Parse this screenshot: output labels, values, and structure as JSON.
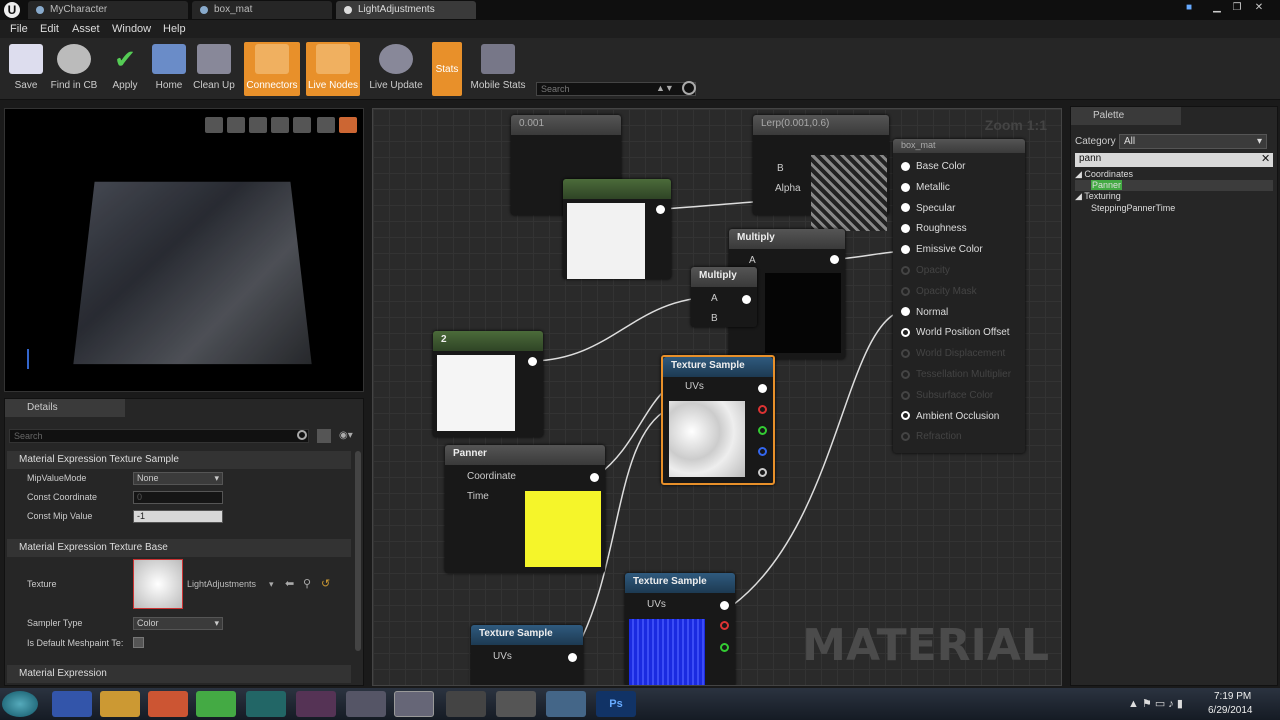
{
  "window": {
    "tabs": [
      "MyCharacter",
      "box_mat",
      "LightAdjustments"
    ],
    "active_tab": 2
  },
  "menu": [
    "File",
    "Edit",
    "Asset",
    "Window",
    "Help"
  ],
  "toolbar": {
    "buttons": [
      {
        "label": "Save",
        "active": false
      },
      {
        "label": "Find in CB",
        "active": false
      },
      {
        "label": "Apply",
        "active": false
      },
      {
        "label": "Home",
        "active": false
      },
      {
        "label": "Clean Up",
        "active": false
      },
      {
        "label": "Connectors",
        "active": true
      },
      {
        "label": "Live Nodes",
        "active": true
      },
      {
        "label": "Live Update",
        "active": false
      },
      {
        "label": "Stats",
        "active": true
      },
      {
        "label": "Mobile Stats",
        "active": false
      }
    ],
    "search_placeholder": "Search"
  },
  "details": {
    "tab": "Details",
    "search_placeholder": "Search",
    "section1": "Material Expression Texture Sample",
    "mip_label": "MipValueMode",
    "mip_value": "None",
    "coord_label": "Const Coordinate",
    "coord_value": "0",
    "constmip_label": "Const Mip Value",
    "constmip_value": "-1",
    "section2": "Material Expression Texture Base",
    "texture_label": "Texture",
    "texture_value": "LightAdjustments",
    "sampler_label": "Sampler Type",
    "sampler_value": "Color",
    "meshpaint_label": "Is Default Meshpaint Te:",
    "section3": "Material Expression"
  },
  "graph": {
    "watermark": "MATERIAL",
    "zoom": "Zoom 1:1",
    "const1": "0.001",
    "lerp": "Lerp(0.001,0.6)",
    "box_mat_title": "box_mat",
    "multiply1": "Multiply",
    "multiply2": "Multiply",
    "pin_a": "A",
    "pin_b": "B",
    "pin_alpha": "Alpha",
    "const2": "2",
    "texsample1": "Texture Sample",
    "texsample2": "Texture Sample",
    "texsample3": "Texture Sample",
    "uvs": "UVs",
    "panner": "Panner",
    "coordinate": "Coordinate",
    "time": "Time",
    "outputs": [
      "Base Color",
      "Metallic",
      "Specular",
      "Roughness",
      "Emissive Color",
      "Opacity",
      "Opacity Mask",
      "Normal",
      "World Position Offset",
      "World Displacement",
      "Tessellation Multiplier",
      "Subsurface Color",
      "Ambient Occlusion",
      "Refraction"
    ]
  },
  "palette": {
    "tab": "Palette",
    "category_label": "Category",
    "category_value": "All",
    "search_value": "pann",
    "groups": [
      {
        "name": "Coordinates",
        "items": [
          "Panner"
        ]
      },
      {
        "name": "Texturing",
        "items": [
          "SteppingPannerTime"
        ]
      }
    ],
    "highlight": "Panner"
  },
  "taskbar": {
    "time": "7:19 PM",
    "date": "6/29/2014"
  }
}
